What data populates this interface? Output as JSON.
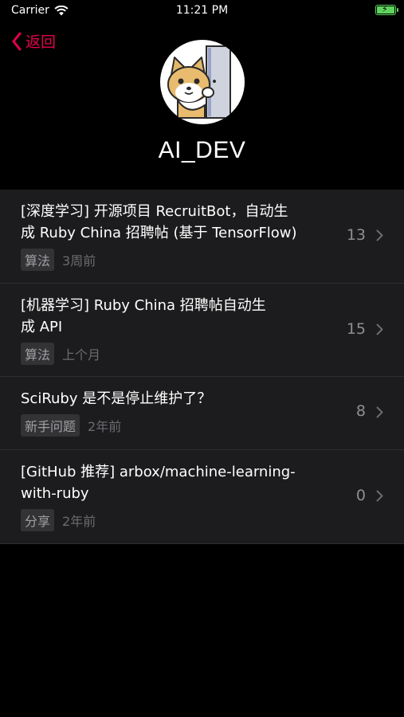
{
  "status_bar": {
    "carrier": "Carrier",
    "time": "11:21 PM"
  },
  "nav": {
    "back_label": "返回",
    "accent_color": "#e6004c"
  },
  "profile": {
    "username": "AI_DEV"
  },
  "topics": [
    {
      "title_line1": "[深度学习] 开源项目 RecruitBot，自动生",
      "title_line2": "成 Ruby China 招聘帖 (基于 TensorFlow)",
      "node": "算法",
      "time": "3周前",
      "replies": "13"
    },
    {
      "title_line1": "[机器学习] Ruby China 招聘帖自动生",
      "title_line2": "成 API",
      "node": "算法",
      "time": "上个月",
      "replies": "15"
    },
    {
      "title_line1": "SciRuby 是不是停止维护了？",
      "title_line2": "",
      "node": "新手问题",
      "time": "2年前",
      "replies": "8"
    },
    {
      "title_line1": "[GitHub 推荐] arbox/machine-learning-",
      "title_line2": "with-ruby",
      "node": "分享",
      "time": "2年前",
      "replies": "0"
    }
  ]
}
